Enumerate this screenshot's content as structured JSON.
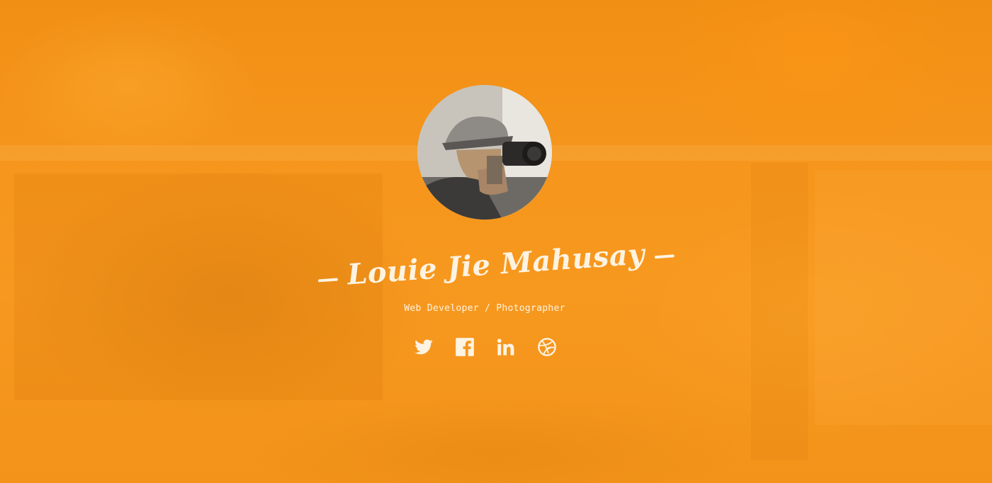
{
  "profile": {
    "name": "Louie Jie Mahusay",
    "role": "Web Developer / Photographer",
    "avatar_alt": "Portrait of a photographer holding a camera"
  },
  "social_links": [
    {
      "name": "twitter-icon",
      "label": "Twitter"
    },
    {
      "name": "facebook-icon",
      "label": "Facebook"
    },
    {
      "name": "linkedin-icon",
      "label": "LinkedIn"
    },
    {
      "name": "dribbble-icon",
      "label": "Dribbble"
    }
  ],
  "colors": {
    "background": "#f7941d",
    "text": "#fdf3e2"
  }
}
